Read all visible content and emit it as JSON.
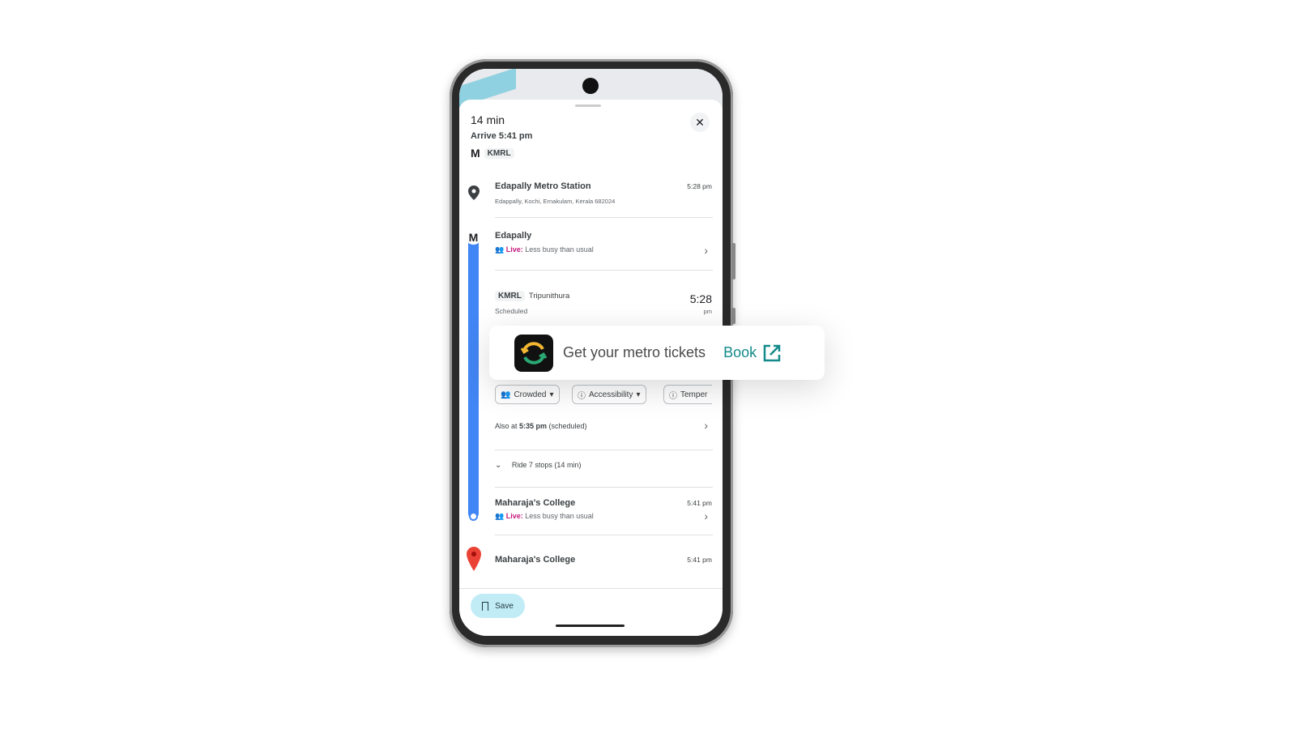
{
  "summary": {
    "duration": "14 min",
    "arrive": "Arrive 5:41 pm",
    "transit_mode": "M",
    "agency": "KMRL"
  },
  "origin": {
    "name": "Edapally Metro Station",
    "address": "Edappally, Kochi, Ernakulam, Kerala 682024",
    "time": "5:28 pm"
  },
  "board": {
    "stop": "Edapally",
    "live_label": "Live:",
    "live_text": "Less busy than usual"
  },
  "train": {
    "agency": "KMRL",
    "headsign": "Tripunithura",
    "status": "Scheduled",
    "time": "5:28",
    "ampm": "pm"
  },
  "filters": [
    {
      "label": "Crowded"
    },
    {
      "label": "Accessibility"
    },
    {
      "label": "Temper"
    }
  ],
  "also": {
    "prefix": "Also at ",
    "time": "5:35 pm",
    "suffix": " (scheduled)"
  },
  "ride": {
    "label": "Ride 7 stops (14 min)"
  },
  "alight": {
    "stop": "Maharaja's College",
    "time": "5:41 pm",
    "live_label": "Live:",
    "live_text": "Less busy than usual"
  },
  "destination": {
    "name": "Maharaja's College",
    "time": "5:41 pm"
  },
  "footer": {
    "save_label": "Save"
  },
  "promo": {
    "text": "Get your metro tickets",
    "book_label": "Book"
  },
  "colors": {
    "route": "#4285f4",
    "live": "#c5197d",
    "book": "#148a8a",
    "save_bg": "#c2ecf5"
  }
}
